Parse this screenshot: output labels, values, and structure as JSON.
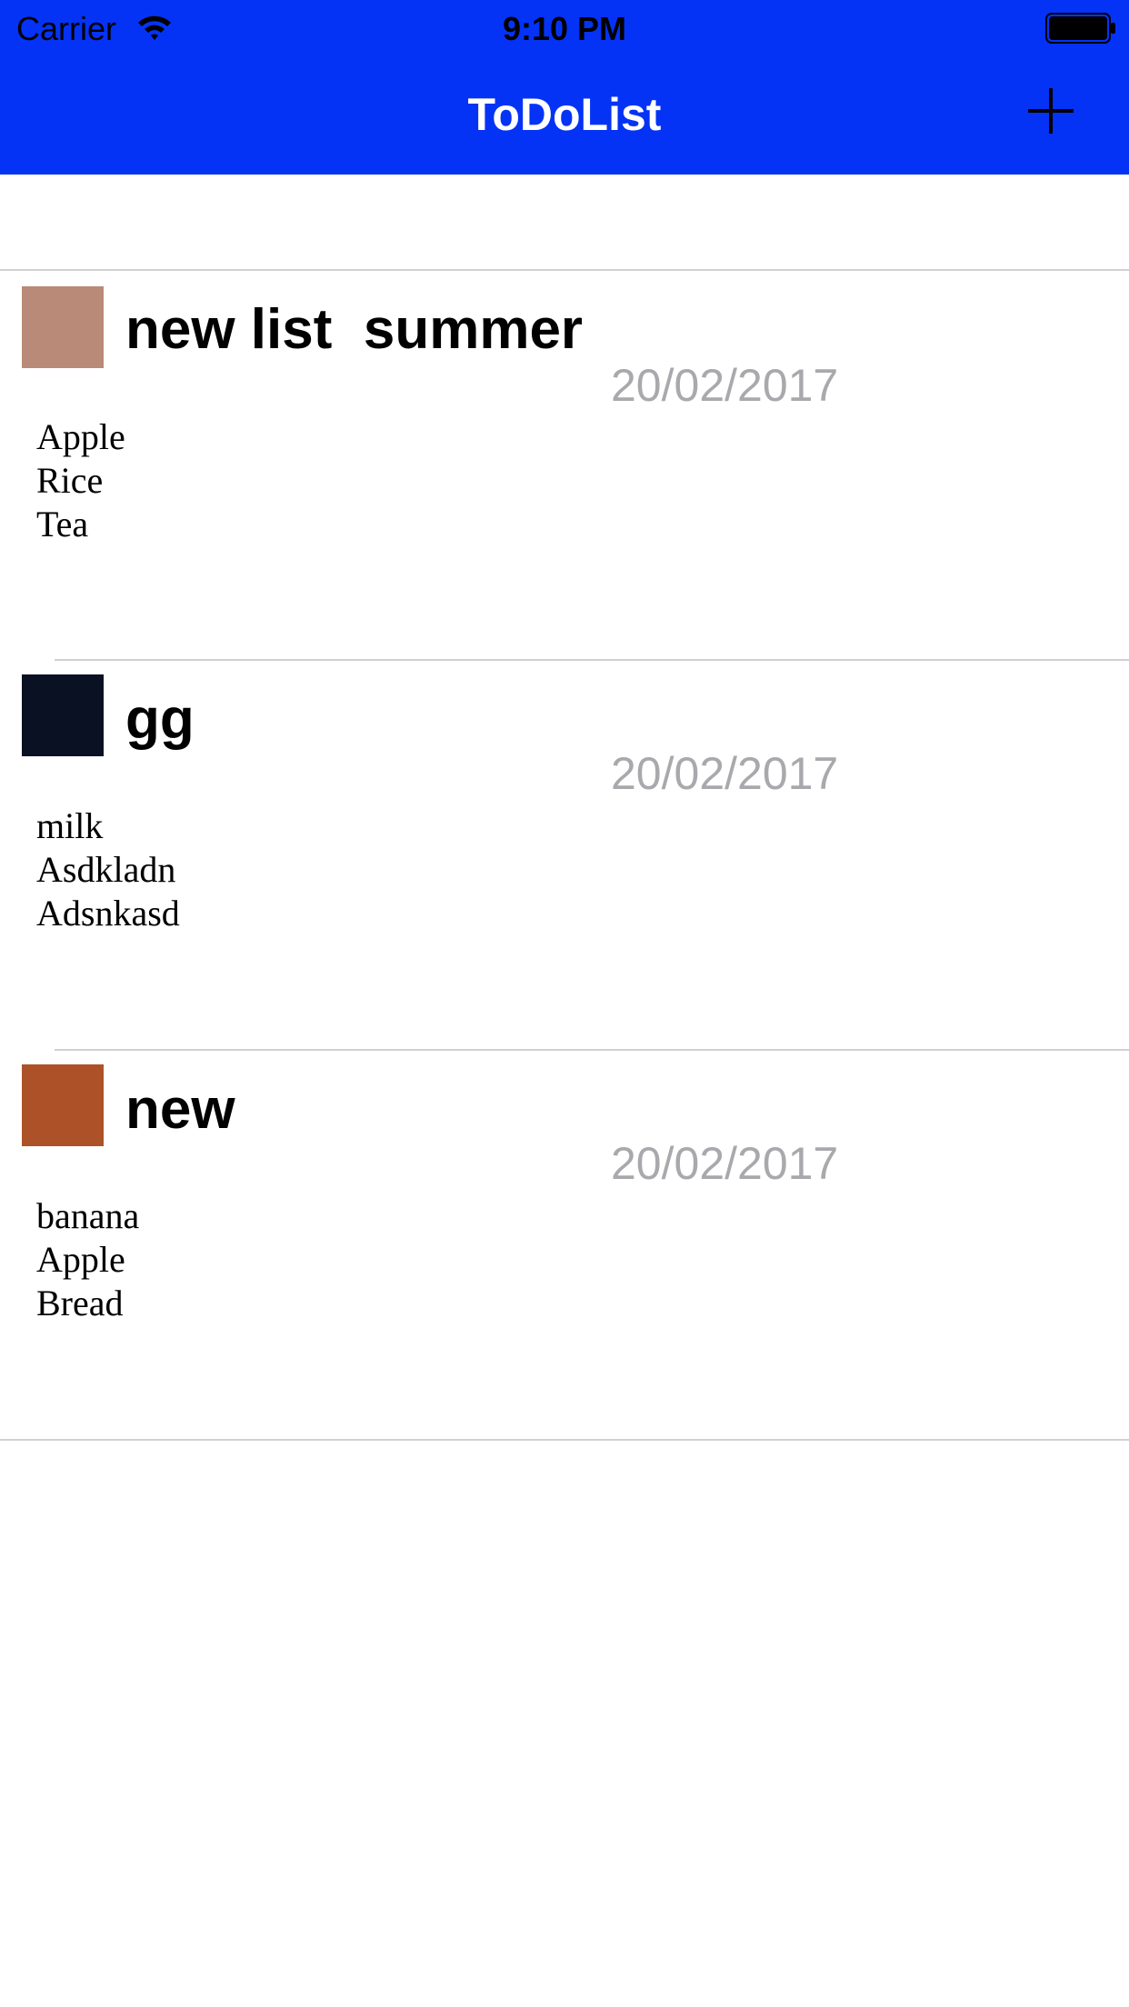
{
  "status_bar": {
    "carrier": "Carrier",
    "time": "9:10 PM",
    "wifi_icon": "wifi-icon",
    "battery_icon": "battery-icon"
  },
  "nav": {
    "title": "ToDoList",
    "add_icon": "plus-icon",
    "background_color": "#0533F5"
  },
  "lists": [
    {
      "title": "new list  summer",
      "date": "20/02/2017",
      "color": "#B98A78",
      "items": [
        "Apple",
        "Rice",
        "Tea"
      ]
    },
    {
      "title": "gg",
      "date": "20/02/2017",
      "color": "#0A1122",
      "items": [
        "milk",
        "Asdkladn",
        "Adsnkasd"
      ]
    },
    {
      "title": "new",
      "date": "20/02/2017",
      "color": "#AD5128",
      "items": [
        "banana",
        "Apple",
        "Bread"
      ]
    }
  ]
}
